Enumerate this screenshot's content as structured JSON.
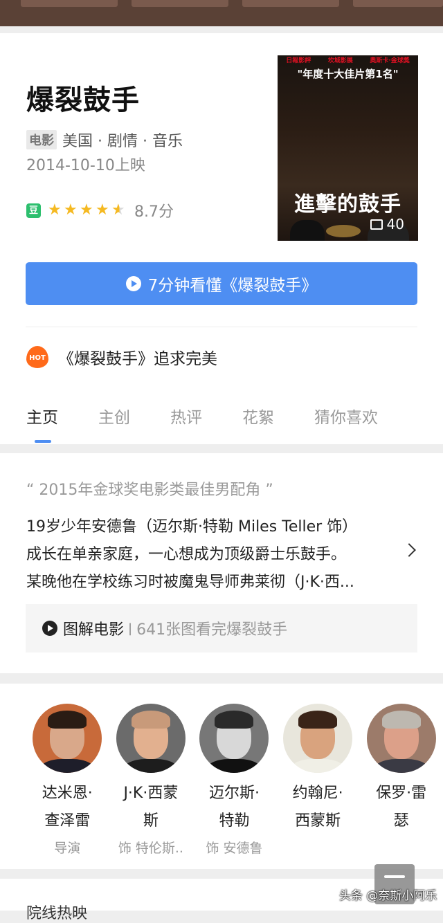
{
  "movie": {
    "title": "爆裂鼓手",
    "type_tag": "电影",
    "meta": "美国 · 剧情 · 音乐",
    "release": "2014-10-10上映",
    "rating_badge": "豆",
    "rating_score": "8.7分",
    "rating_stars": 4.5,
    "star_glyph": "★"
  },
  "poster": {
    "tagline": "\"年度十大佳片第1名\"",
    "title_text": "進擊的鼓手",
    "badge_top": [
      "日報影評",
      "坎城影展",
      "奧斯卡·金球獎"
    ],
    "image_count": "40"
  },
  "watch_button": {
    "label": "7分钟看懂《爆裂鼓手》"
  },
  "hot": {
    "badge": "HOT",
    "text": "《爆裂鼓手》追求完美"
  },
  "tabs": [
    {
      "label": "主页",
      "active": true
    },
    {
      "label": "主创",
      "active": false
    },
    {
      "label": "热评",
      "active": false
    },
    {
      "label": "花絮",
      "active": false
    },
    {
      "label": "猜你喜欢",
      "active": false
    }
  ],
  "summary": {
    "quote": "“ 2015年金球奖电影类最佳男配角 ”",
    "lines": [
      "19岁少年安德鲁（迈尔斯·特勒 Miles Teller 饰）",
      "成长在单亲家庭，一心想成为顶级爵士乐鼓手。",
      "某晚他在学校练习时被魔鬼导师弗莱彻（J·K·西..."
    ]
  },
  "illustrated": {
    "label": "图解电影",
    "separator": "|",
    "desc": "641张图看完爆裂鼓手"
  },
  "cast": [
    {
      "name_line1": "达米恩·",
      "name_line2": "查泽雷",
      "role": "导演",
      "icon": "person-avatar",
      "skin": "#d9a88a",
      "hair": "#2a1c14",
      "body": "#1e1e2a",
      "bg": "#c86a3a"
    },
    {
      "name_line1": "J·K·西蒙",
      "name_line2": "斯",
      "role": "饰 特伦斯..",
      "icon": "person-avatar",
      "skin": "#e2b08f",
      "hair": "#c89a7a",
      "body": "#1d1d1d",
      "bg": "#6b6b6b"
    },
    {
      "name_line1": "迈尔斯·",
      "name_line2": "特勒",
      "role": "饰 安德鲁",
      "icon": "person-avatar",
      "skin": "#d8d8d8",
      "hair": "#2a2a2a",
      "body": "#111111",
      "bg": "#777777"
    },
    {
      "name_line1": "约翰尼·",
      "name_line2": "西蒙斯",
      "role": "",
      "icon": "person-avatar",
      "skin": "#d9a37e",
      "hair": "#3a2418",
      "body": "#f0efe6",
      "bg": "#e8e6dc"
    },
    {
      "name_line1": "保罗·雷",
      "name_line2": "瑟",
      "role": "",
      "icon": "person-avatar",
      "skin": "#dca089",
      "hair": "#bdb8b0",
      "body": "#3a3a44",
      "bg": "#9c7b6a"
    }
  ],
  "next_section": "院线热映",
  "watermark": "头条 @奈斯小阿乐"
}
